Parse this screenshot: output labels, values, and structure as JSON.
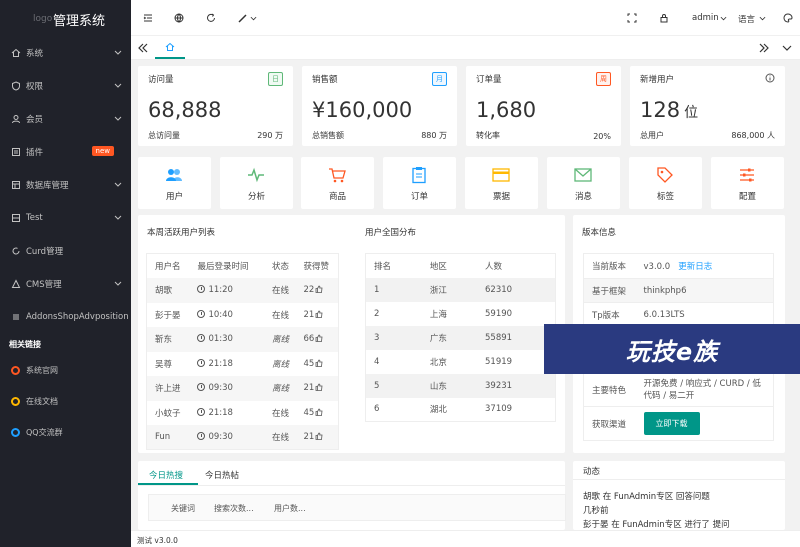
{
  "sidebar": {
    "logo_small": "logo",
    "logo_title": "管理系统",
    "items": [
      {
        "label": "系统",
        "icon": "home-icon"
      },
      {
        "label": "权限",
        "icon": "shield-icon"
      },
      {
        "label": "会员",
        "icon": "user-icon"
      },
      {
        "label": "插件",
        "icon": "plugin-icon",
        "badge": "new"
      },
      {
        "label": "数据库管理",
        "icon": "database-icon"
      },
      {
        "label": "Test",
        "icon": "grid-icon"
      },
      {
        "label": "Curd管理",
        "icon": "refresh-icon"
      },
      {
        "label": "CMS管理",
        "icon": "cms-icon"
      },
      {
        "label": "AddonsShopAdvposition",
        "icon": "list-icon"
      }
    ],
    "group_title": "相关链接",
    "links": [
      {
        "label": "系统官网",
        "color": "#ff5722"
      },
      {
        "label": "在线文档",
        "color": "#ffb800"
      },
      {
        "label": "QQ交流群",
        "color": "#1e9fff"
      }
    ]
  },
  "header": {
    "user": "admin",
    "language": "语言"
  },
  "stats": [
    {
      "title": "访问量",
      "tag": "日",
      "tag_color": "#5fb878",
      "value": "68,888",
      "unit": "",
      "foot_label": "总访问量",
      "foot_value": "290 万"
    },
    {
      "title": "销售额",
      "tag": "月",
      "tag_color": "#1e9fff",
      "value": "¥160,000",
      "unit": "",
      "foot_label": "总销售额",
      "foot_value": "880 万"
    },
    {
      "title": "订单量",
      "tag": "周",
      "tag_color": "#ff5722",
      "value": "1,680",
      "unit": "",
      "foot_label": "转化率",
      "foot_value": "20%"
    },
    {
      "title": "新增用户",
      "tag": "",
      "tag_color": "",
      "value": "128",
      "unit": "位",
      "foot_label": "总用户",
      "foot_value": "868,000 人"
    }
  ],
  "shortcuts": [
    {
      "label": "用户",
      "color": "#1e9fff"
    },
    {
      "label": "分析",
      "color": "#5fb878"
    },
    {
      "label": "商品",
      "color": "#ff5722"
    },
    {
      "label": "订单",
      "color": "#1e9fff"
    },
    {
      "label": "票据",
      "color": "#ffb800"
    },
    {
      "label": "消息",
      "color": "#5fb878"
    },
    {
      "label": "标签",
      "color": "#ff5722"
    },
    {
      "label": "配置",
      "color": "#ff5722"
    }
  ],
  "active_users": {
    "title": "本周活跃用户列表",
    "headers": [
      "用户名",
      "最后登录时间",
      "状态",
      "获得赞"
    ],
    "rows": [
      {
        "name": "胡歌",
        "time": "11:20",
        "status": "在线",
        "likes": "22"
      },
      {
        "name": "彭于晏",
        "time": "10:40",
        "status": "在线",
        "likes": "21"
      },
      {
        "name": "靳东",
        "time": "01:30",
        "status": "离线",
        "likes": "66"
      },
      {
        "name": "吴尊",
        "time": "21:18",
        "status": "离线",
        "likes": "45"
      },
      {
        "name": "许上进",
        "time": "09:30",
        "status": "离线",
        "likes": "21"
      },
      {
        "name": "小蚊子",
        "time": "21:18",
        "status": "在线",
        "likes": "45"
      },
      {
        "name": "Fun",
        "time": "09:30",
        "status": "在线",
        "likes": "21"
      }
    ]
  },
  "region": {
    "title": "用户全国分布",
    "headers": [
      "排名",
      "地区",
      "人数"
    ],
    "rows": [
      {
        "rank": "1",
        "area": "浙江",
        "count": "62310"
      },
      {
        "rank": "2",
        "area": "上海",
        "count": "59190"
      },
      {
        "rank": "3",
        "area": "广东",
        "count": "55891"
      },
      {
        "rank": "4",
        "area": "北京",
        "count": "51919"
      },
      {
        "rank": "5",
        "area": "山东",
        "count": "39231"
      },
      {
        "rank": "6",
        "area": "湖北",
        "count": "37109"
      }
    ]
  },
  "version": {
    "title": "版本信息",
    "current_label": "当前版本",
    "current_value": "v3.0.0",
    "changelog": "更新日志",
    "framework_label": "基于框架",
    "framework_value": "thinkphp6",
    "tp_label": "Tp版本",
    "tp_value": "6.0.13LTS",
    "feature_label": "主要特色",
    "feature_value": "开源免费 / 响应式 / CURD / 低代码 / 易二开",
    "channel_label": "获取渠道",
    "download": "立即下载"
  },
  "hot": {
    "tabs": [
      "今日热搜",
      "今日热帖"
    ],
    "headers": [
      "关键词",
      "搜索次数...",
      "用户数..."
    ]
  },
  "news": {
    "title": "动态",
    "line1": "胡歌 在 FunAdmin专区 回答问题",
    "line2": "几秒前",
    "line3": "彭于晏 在 FunAdmin专区 进行了 提问"
  },
  "footer": "测试 v3.0.0",
  "watermark": "玩技e族"
}
